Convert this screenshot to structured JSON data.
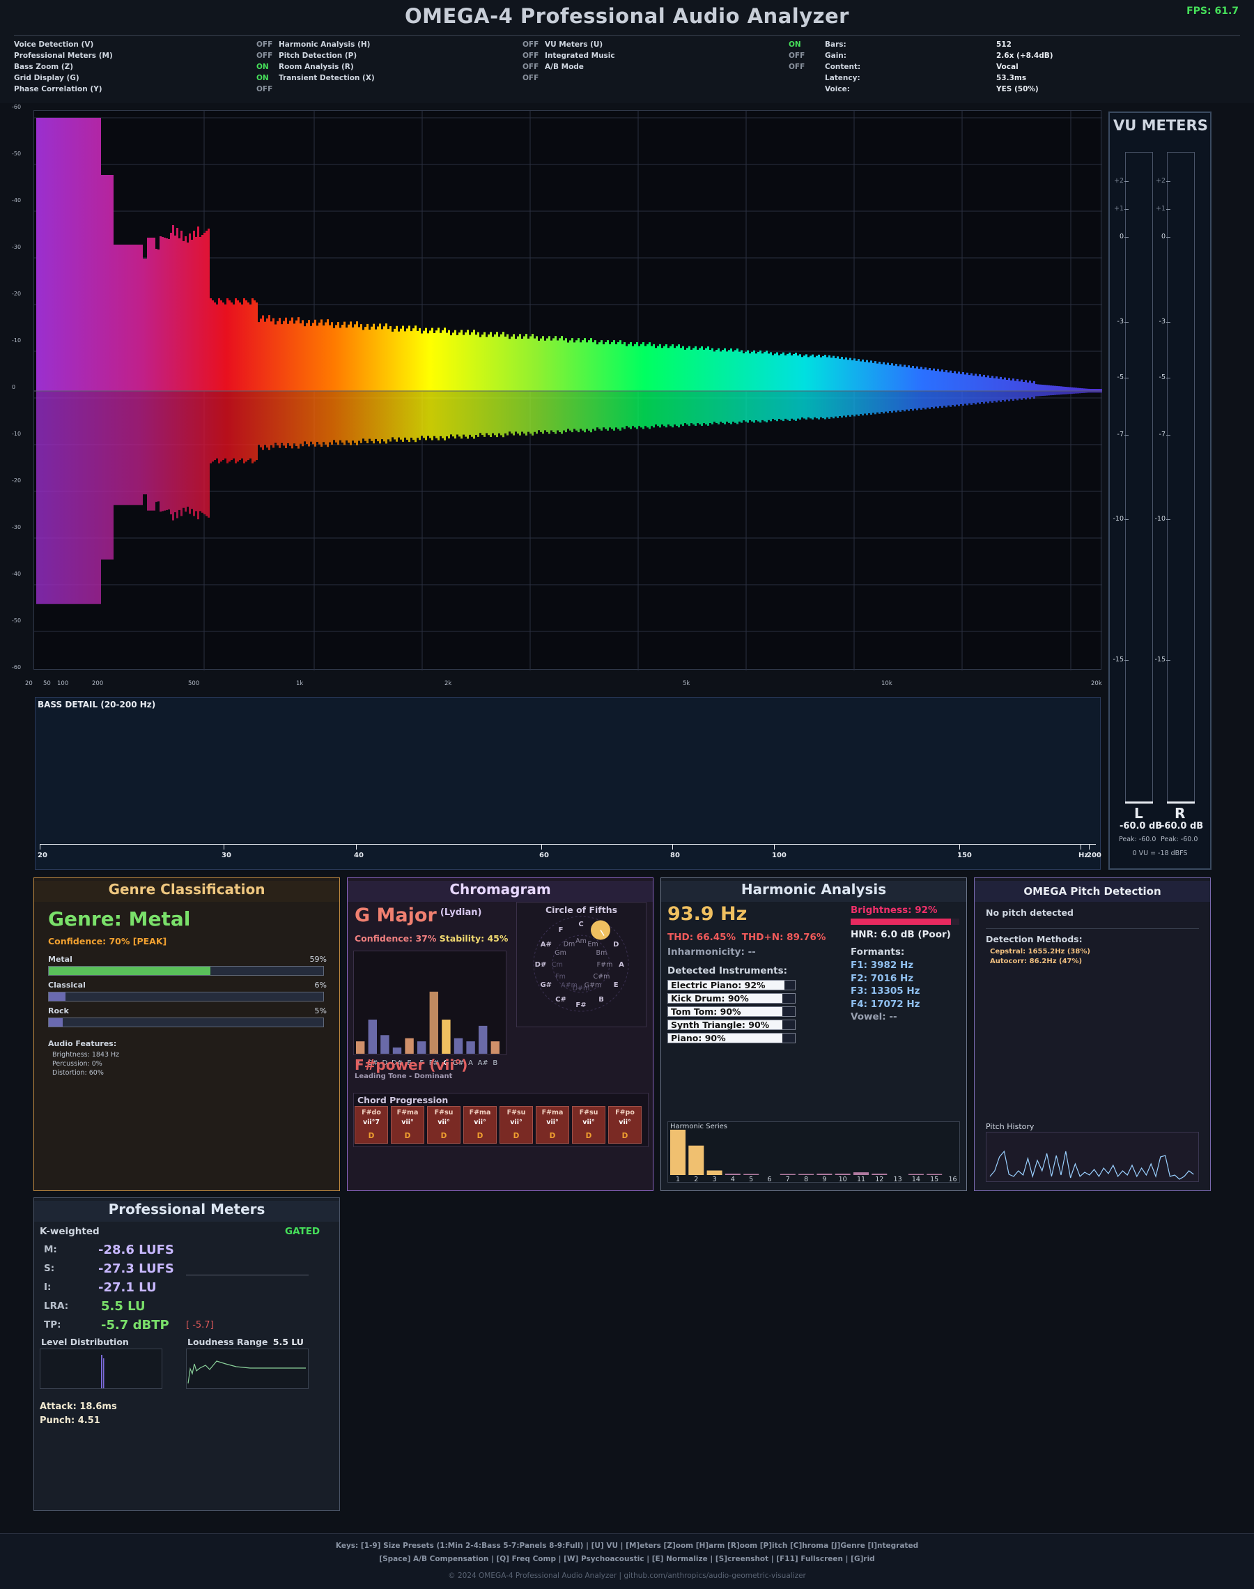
{
  "header": {
    "title": "OMEGA-4 Professional Audio Analyzer",
    "fps": "FPS: 61.7"
  },
  "status": {
    "col1": [
      {
        "label": "Voice Detection (V)",
        "value": "OFF"
      },
      {
        "label": "Professional Meters (M)",
        "value": "OFF"
      },
      {
        "label": "Bass Zoom (Z)",
        "value": "ON"
      },
      {
        "label": "Grid Display (G)",
        "value": "ON"
      },
      {
        "label": "Phase Correlation (Y)",
        "value": "OFF"
      }
    ],
    "col2": [
      {
        "label": "Harmonic Analysis (H)",
        "value": "OFF"
      },
      {
        "label": "Pitch Detection (P)",
        "value": "OFF"
      },
      {
        "label": "Room Analysis (R)",
        "value": "OFF"
      },
      {
        "label": "Transient Detection (X)",
        "value": "OFF"
      }
    ],
    "col3": [
      {
        "label": "VU Meters (U)",
        "value": "ON"
      },
      {
        "label": "Integrated Music",
        "value": "OFF"
      },
      {
        "label": "A/B Mode",
        "value": "OFF"
      }
    ],
    "info": [
      {
        "label": "Bars:",
        "value": "512"
      },
      {
        "label": "Gain:",
        "value": "2.6x (+8.4dB)"
      },
      {
        "label": "Content:",
        "value": "Vocal"
      },
      {
        "label": "Latency:",
        "value": "53.3ms"
      },
      {
        "label": "Voice:",
        "value": "YES (50%)"
      }
    ]
  },
  "spectrum": {
    "y_labels": [
      "-60",
      "-50",
      "-40",
      "-30",
      "-20",
      "-10",
      "0",
      "-10",
      "-20",
      "-30",
      "-40",
      "-50",
      "-60"
    ],
    "x_labels": [
      "20",
      "50",
      "100",
      "200",
      "500",
      "1k",
      "2k",
      "5k",
      "10k",
      "20k"
    ]
  },
  "bass": {
    "title": "BASS DETAIL (20-200 Hz)",
    "x_labels": [
      "20",
      "30",
      "40",
      "60",
      "80",
      "100",
      "150",
      "Hz",
      "200"
    ]
  },
  "vu": {
    "title": "VU METERS",
    "scale": [
      "+2",
      "+1",
      "0",
      "-3",
      "-5",
      "-7",
      "-10",
      "-15"
    ],
    "left_label": "L",
    "right_label": "R",
    "left_db": "-60.0 dB",
    "right_db": "-60.0 dB",
    "left_peak": "Peak: -60.0",
    "right_peak": "Peak: -60.0",
    "ref": "0 VU = -18 dBFS"
  },
  "genre": {
    "title": "Genre Classification",
    "genre": "Genre: Metal",
    "confidence": "Confidence: 70% [PEAK]",
    "items": [
      {
        "name": "Metal",
        "pct": "59%",
        "value": 0.59
      },
      {
        "name": "Classical",
        "pct": "6%",
        "value": 0.06
      },
      {
        "name": "Rock",
        "pct": "5%",
        "value": 0.05
      }
    ],
    "features_title": "Audio Features:",
    "features": [
      "Brightness: 1843 Hz",
      "Percussion: 0%",
      "Distortion: 60%"
    ]
  },
  "chroma": {
    "title": "Chromagram",
    "key": "G Major",
    "mode": "(Lydian)",
    "confidence": "Confidence: 37%",
    "stability": "Stability: 45%",
    "notes": [
      "C",
      "C#",
      "D",
      "D#",
      "E",
      "F",
      "F#",
      "G",
      "G#",
      "A",
      "A#",
      "B"
    ],
    "values": [
      0.2,
      0.55,
      0.3,
      0.1,
      0.25,
      0.2,
      1.0,
      0.55,
      0.25,
      0.2,
      0.45,
      0.2
    ],
    "chord": "F#power (vii°)",
    "function": "Leading Tone - Dominant",
    "circle_title": "Circle of Fifths",
    "circle_major": [
      "C",
      "G",
      "D",
      "A",
      "E",
      "B",
      "F#",
      "C#",
      "G#",
      "D#",
      "A#",
      "F"
    ],
    "circle_minor": [
      "Am",
      "Em",
      "Bm",
      "F#m",
      "C#m",
      "G#m",
      "D#m",
      "A#m",
      "Fm",
      "Cm",
      "Gm",
      "Dm"
    ],
    "prog_title": "Chord Progression",
    "progression": [
      {
        "name": "F#do",
        "roman": "vii°7",
        "fn": "D"
      },
      {
        "name": "F#ma",
        "roman": "vii°",
        "fn": "D"
      },
      {
        "name": "F#su",
        "roman": "vii°",
        "fn": "D"
      },
      {
        "name": "F#ma",
        "roman": "vii°",
        "fn": "D"
      },
      {
        "name": "F#su",
        "roman": "vii°",
        "fn": "D"
      },
      {
        "name": "F#ma",
        "roman": "vii°",
        "fn": "D"
      },
      {
        "name": "F#su",
        "roman": "vii°",
        "fn": "D"
      },
      {
        "name": "F#po",
        "roman": "vii°",
        "fn": "D"
      }
    ]
  },
  "harmonic": {
    "title": "Harmonic Analysis",
    "freq": "93.9 Hz",
    "thd": "THD: 66.45%",
    "thdn": "THD+N: 89.76%",
    "inharm": "Inharmonicity: --",
    "brightness": "Brightness: 92%",
    "brightness_value": 0.92,
    "hnr": "HNR: 6.0 dB (Poor)",
    "formants_title": "Formants:",
    "formants": [
      "F1: 3982 Hz",
      "F2: 7016 Hz",
      "F3: 13305 Hz",
      "F4: 17072 Hz",
      "Vowel: --"
    ],
    "inst_title": "Detected Instruments:",
    "instruments": [
      {
        "label": "Electric Piano: 92%",
        "value": 0.92
      },
      {
        "label": "Kick Drum: 90%",
        "value": 0.9
      },
      {
        "label": "Tom Tom: 90%",
        "value": 0.9
      },
      {
        "label": "Synth Triangle: 90%",
        "value": 0.9
      },
      {
        "label": "Piano: 90%",
        "value": 0.9
      }
    ],
    "series_title": "Harmonic Series",
    "series_labels": [
      "1",
      "2",
      "3",
      "4",
      "5",
      "6",
      "7",
      "8",
      "9",
      "10",
      "11",
      "12",
      "13",
      "14",
      "15",
      "16"
    ],
    "series_values": [
      1.0,
      0.65,
      0.1,
      0.03,
      0.02,
      0.0,
      0.01,
      0.02,
      0.03,
      0.03,
      0.06,
      0.03,
      0.0,
      0.01,
      0.01,
      0.0
    ]
  },
  "pitch": {
    "title": "OMEGA Pitch Detection",
    "status": "No pitch detected",
    "methods_title": "Detection Methods:",
    "methods": [
      "Cepstral: 1655.2Hz (38%)",
      "Autocorr: 86.2Hz (47%)"
    ],
    "history_title": "Pitch History"
  },
  "meters": {
    "title": "Professional Meters",
    "weighting": "K-weighted",
    "gated": "GATED",
    "rows": [
      {
        "label": "M:",
        "value": "-28.6 LUFS"
      },
      {
        "label": "S:",
        "value": "-27.3 LUFS"
      },
      {
        "label": "I:",
        "value": "-27.1 LU"
      },
      {
        "label": "LRA:",
        "value": "5.5 LU"
      },
      {
        "label": "TP:",
        "value": "-5.7 dBTP"
      }
    ],
    "tp_peak": "[ -5.7]",
    "dist_title": "Level Distribution",
    "range_title": "Loudness Range",
    "range_value": "5.5 LU",
    "attack": "Attack: 18.6ms",
    "punch": "Punch: 4.51"
  },
  "footer": {
    "line1": "Keys: [1-9] Size Presets (1:Min 2-4:Bass 5-7:Panels 8-9:Full) | [U] VU | [M]eters [Z]oom [H]arm [R]oom [P]itch [C]hroma [J]Genre [I]ntegrated",
    "line2": "[Space] A/B Compensation | [Q] Freq Comp | [W] Psychoacoustic | [E] Normalize | [S]creenshot | [F11] Fullscreen | [G]rid",
    "line3": "© 2024 OMEGA-4 Professional Audio Analyzer | github.com/anthropics/audio-geometric-visualizer"
  },
  "colors": {
    "accent_green": "#46e05a",
    "genre_orange": "#e8a850",
    "chroma_purple": "#8a64c0",
    "harmonic_yellow": "#f0c060"
  }
}
